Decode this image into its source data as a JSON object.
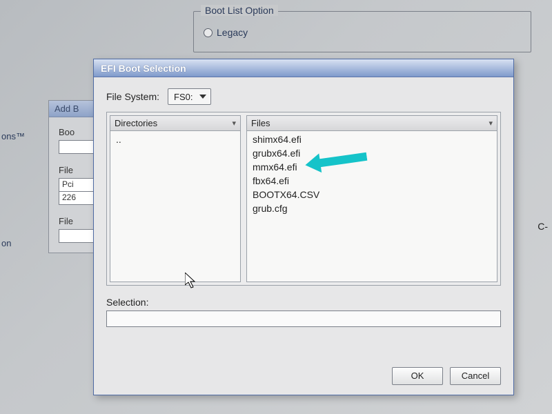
{
  "background": {
    "boot_list_group": "Boot List Option",
    "legacy_label": "Legacy",
    "left_edge_label": "ons™",
    "left_edge_sub": "on"
  },
  "add_boot": {
    "title": "Add B",
    "boot_label": "Boo",
    "file_label": "File",
    "pci_text": "Pci",
    "pci_num": "226",
    "file2_label": "File"
  },
  "dialog": {
    "title": "EFI Boot Selection",
    "fs_label": "File System:",
    "fs_value": "FS0:",
    "dirs_header": "Directories",
    "files_header": "Files",
    "dirs_items": [
      ".."
    ],
    "files_items": [
      "shimx64.efi",
      "grubx64.efi",
      "mmx64.efi",
      "fbx64.efi",
      "BOOTX64.CSV",
      "grub.cfg"
    ],
    "selection_label": "Selection:",
    "selection_value": "",
    "ok_label": "OK",
    "cancel_label": "Cancel"
  },
  "right_fragment": "C-"
}
